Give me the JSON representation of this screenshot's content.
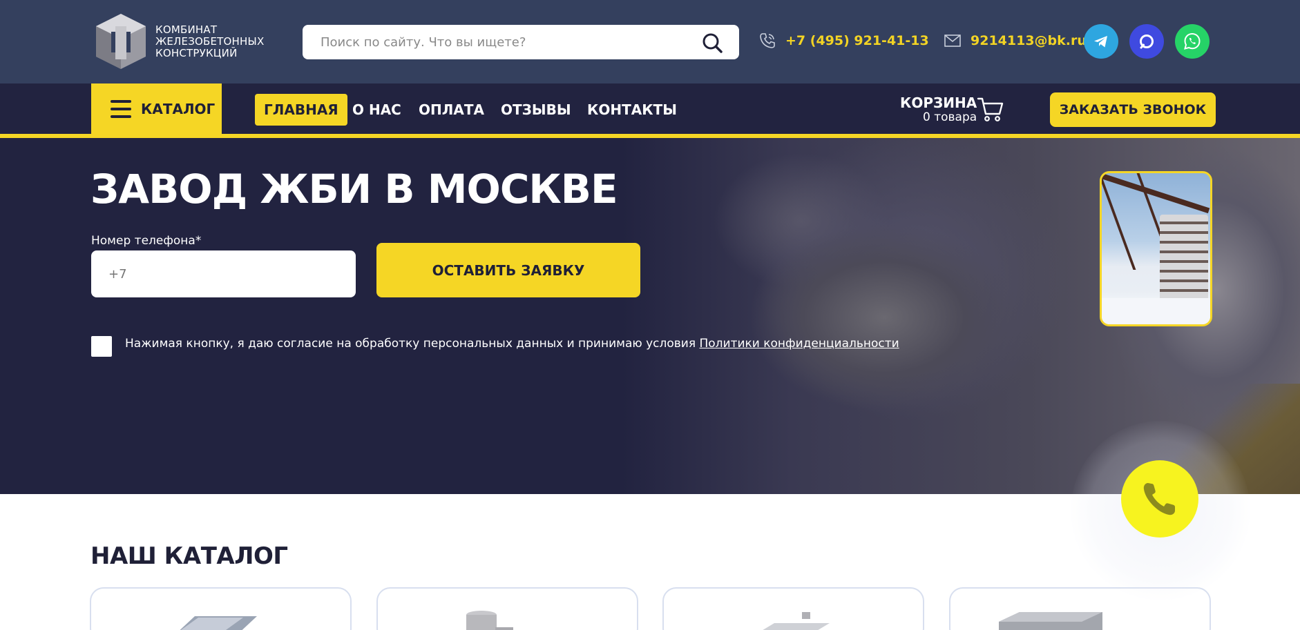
{
  "header": {
    "logo": {
      "line1": "КОМБИНАТ",
      "line2": "ЖЕЛЕЗОБЕТОННЫХ",
      "line3": "КОНСТРУКЦИЙ"
    },
    "search": {
      "placeholder": "Поиск по сайту. Что вы ищете?",
      "value": ""
    },
    "phone": "+7 (495) 921-41-13",
    "email": "9214113@bk.ru",
    "social": [
      {
        "name": "telegram-icon",
        "color": "#2ea6e0"
      },
      {
        "name": "max-messenger-icon",
        "color": "#3f4ae0"
      },
      {
        "name": "whatsapp-icon",
        "color": "#26d367"
      }
    ]
  },
  "nav": {
    "catalog_label": "КАТАЛОГ",
    "items": [
      {
        "label": "ГЛАВНАЯ",
        "active": true
      },
      {
        "label": "О НАС",
        "active": false
      },
      {
        "label": "ОПЛАТА",
        "active": false
      },
      {
        "label": "ОТЗЫВЫ",
        "active": false
      },
      {
        "label": "КОНТАКТЫ",
        "active": false
      }
    ],
    "cart": {
      "title": "КОРЗИНА",
      "count": "0 товара"
    },
    "callback_label": "ЗАКАЗАТЬ ЗВОНОК"
  },
  "hero": {
    "title": "ЗАВОД ЖБИ В МОСКВЕ",
    "phone_label": "Номер телефона*",
    "phone_placeholder": "+7",
    "submit_label": "ОСТАВИТЬ ЗАЯВКУ",
    "consent_text": "Нажимая кнопку, я даю согласие на обработку персональных данных и принимаю условия",
    "consent_link": "Политики конфиденциальности"
  },
  "catalog": {
    "title": "НАШ КАТАЛОГ"
  },
  "colors": {
    "accent": "#f5d625",
    "topbar": "#34405e",
    "navbar": "#222340",
    "hero": "#222340",
    "float_call": "#f7f31f"
  }
}
